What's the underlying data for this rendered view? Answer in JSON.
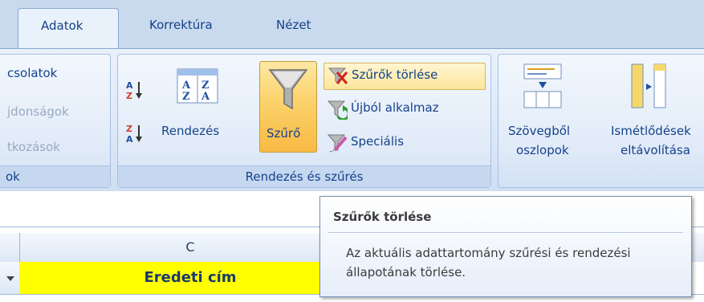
{
  "tabs": [
    {
      "label": "Adatok",
      "active": true
    },
    {
      "label": "Korrektúra",
      "active": false
    },
    {
      "label": "Nézet",
      "active": false
    }
  ],
  "left_group": {
    "items": [
      "csolatok",
      "jdonságok",
      "tkozások"
    ],
    "footer": "ok"
  },
  "sort_filter_group": {
    "sort_button_label": "Rendezés",
    "filter_button_label": "Szűrő",
    "clear_filters_label": "Szűrők törlése",
    "reapply_label": "Újból alkalmaz",
    "advanced_label": "Speciális",
    "footer": "Rendezés és szűrés"
  },
  "data_tools_group": {
    "text_to_columns_line1": "Szövegből",
    "text_to_columns_line2": "oszlopok",
    "remove_duplicates_line1": "Ismétlődések",
    "remove_duplicates_line2": "eltávolítása"
  },
  "tooltip": {
    "title": "Szűrők törlése",
    "body": "Az aktuális adattartomány szűrési és rendezési állapotának törlése."
  },
  "sheet": {
    "column_header": "C",
    "cell_value": "Eredeti cím"
  },
  "colors": {
    "ribbon_text": "#15428b",
    "filter_highlight": "#fbd26a",
    "cell_fill": "#ffff00"
  }
}
